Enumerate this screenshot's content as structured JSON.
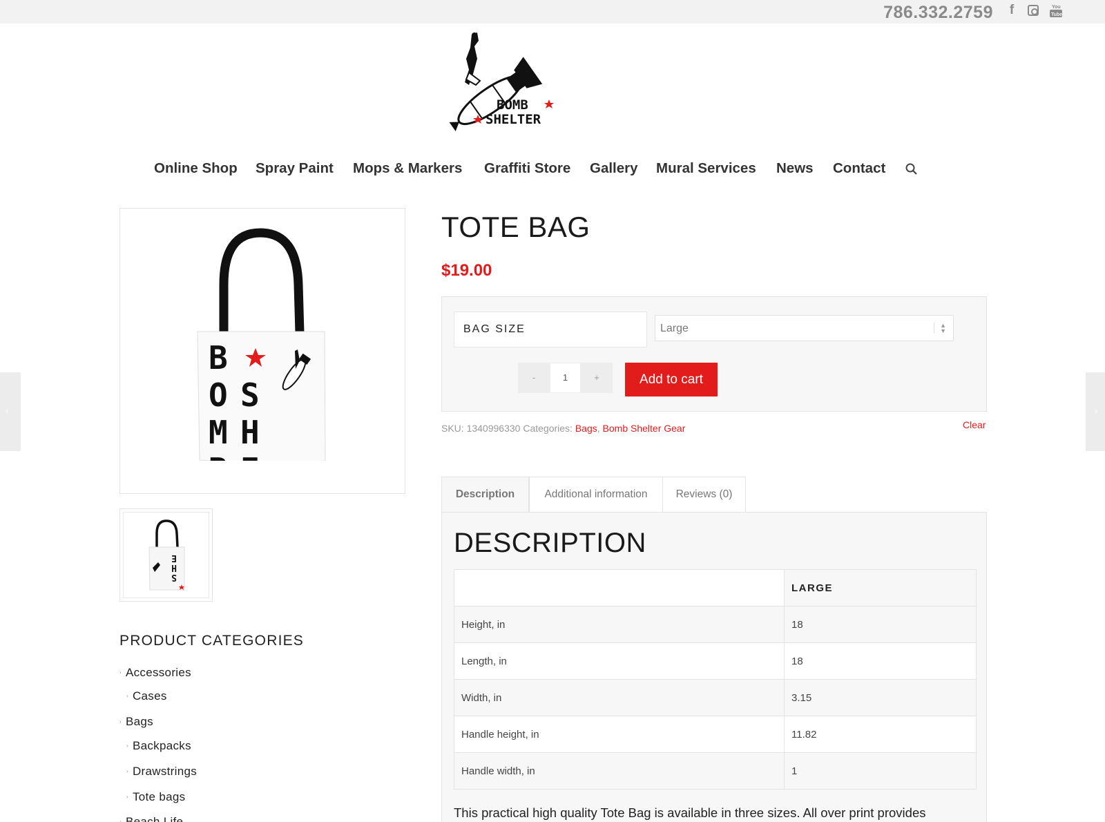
{
  "topbar": {
    "phone": "786.332.2759",
    "social": [
      {
        "name": "facebook-icon",
        "glyph": "f"
      },
      {
        "name": "instagram-icon",
        "glyph": ""
      },
      {
        "name": "youtube-icon",
        "glyph": "You Tube"
      }
    ]
  },
  "logo": {
    "text_line1": "BOMB",
    "text_line2": "SHELTER"
  },
  "nav": {
    "items": [
      "Online Shop",
      "Spray Paint",
      "Mops & Markers",
      "Graffiti Store",
      "Gallery",
      "Mural Services",
      "News",
      "Contact"
    ],
    "search_icon": "search-icon"
  },
  "product": {
    "title": "TOTE BAG",
    "price": "$19.00",
    "variation": {
      "label": "BAG SIZE",
      "selected": "Large"
    },
    "quantity": {
      "minus": "-",
      "value": "1",
      "plus": "+"
    },
    "add_to_cart": "Add to cart",
    "clear": "Clear",
    "meta": {
      "sku_label": "SKU:",
      "sku": "1340996330",
      "categories_label": "Categories:",
      "categories": [
        "Bags",
        "Bomb Shelter Gear"
      ],
      "separator": ","
    },
    "image_text": {
      "col1": [
        "B",
        "O",
        "M",
        "B"
      ],
      "col2": [
        "S",
        "H",
        "E"
      ]
    }
  },
  "tabs": [
    "Description",
    "Additional information",
    "Reviews (0)"
  ],
  "description": {
    "heading": "DESCRIPTION",
    "table": {
      "header": [
        "",
        "LARGE"
      ],
      "rows": [
        [
          "Height, in",
          "18"
        ],
        [
          "Length, in",
          "18"
        ],
        [
          "Width, in",
          "3.15"
        ],
        [
          "Handle height, in",
          "11.82"
        ],
        [
          "Handle width, in",
          "1"
        ]
      ]
    },
    "text": "This practical high quality Tote Bag is available in three sizes. All over print provides"
  },
  "categories": {
    "title": "PRODUCT CATEGORIES",
    "items": [
      {
        "label": "Accessories",
        "level": 0
      },
      {
        "label": "Cases",
        "level": 1
      },
      {
        "label": "Bags",
        "level": 0
      },
      {
        "label": "Backpacks",
        "level": 1
      },
      {
        "label": "Drawstrings",
        "level": 1
      },
      {
        "label": "Tote bags",
        "level": 1
      },
      {
        "label": "Beach Life",
        "level": 0
      }
    ]
  },
  "side_nav": {
    "prev": "‹",
    "next": "›"
  },
  "colors": {
    "accent": "#e31b1b",
    "panel": "#f7f7f7",
    "border": "#e3e3e3",
    "nav_text": "#333333"
  }
}
